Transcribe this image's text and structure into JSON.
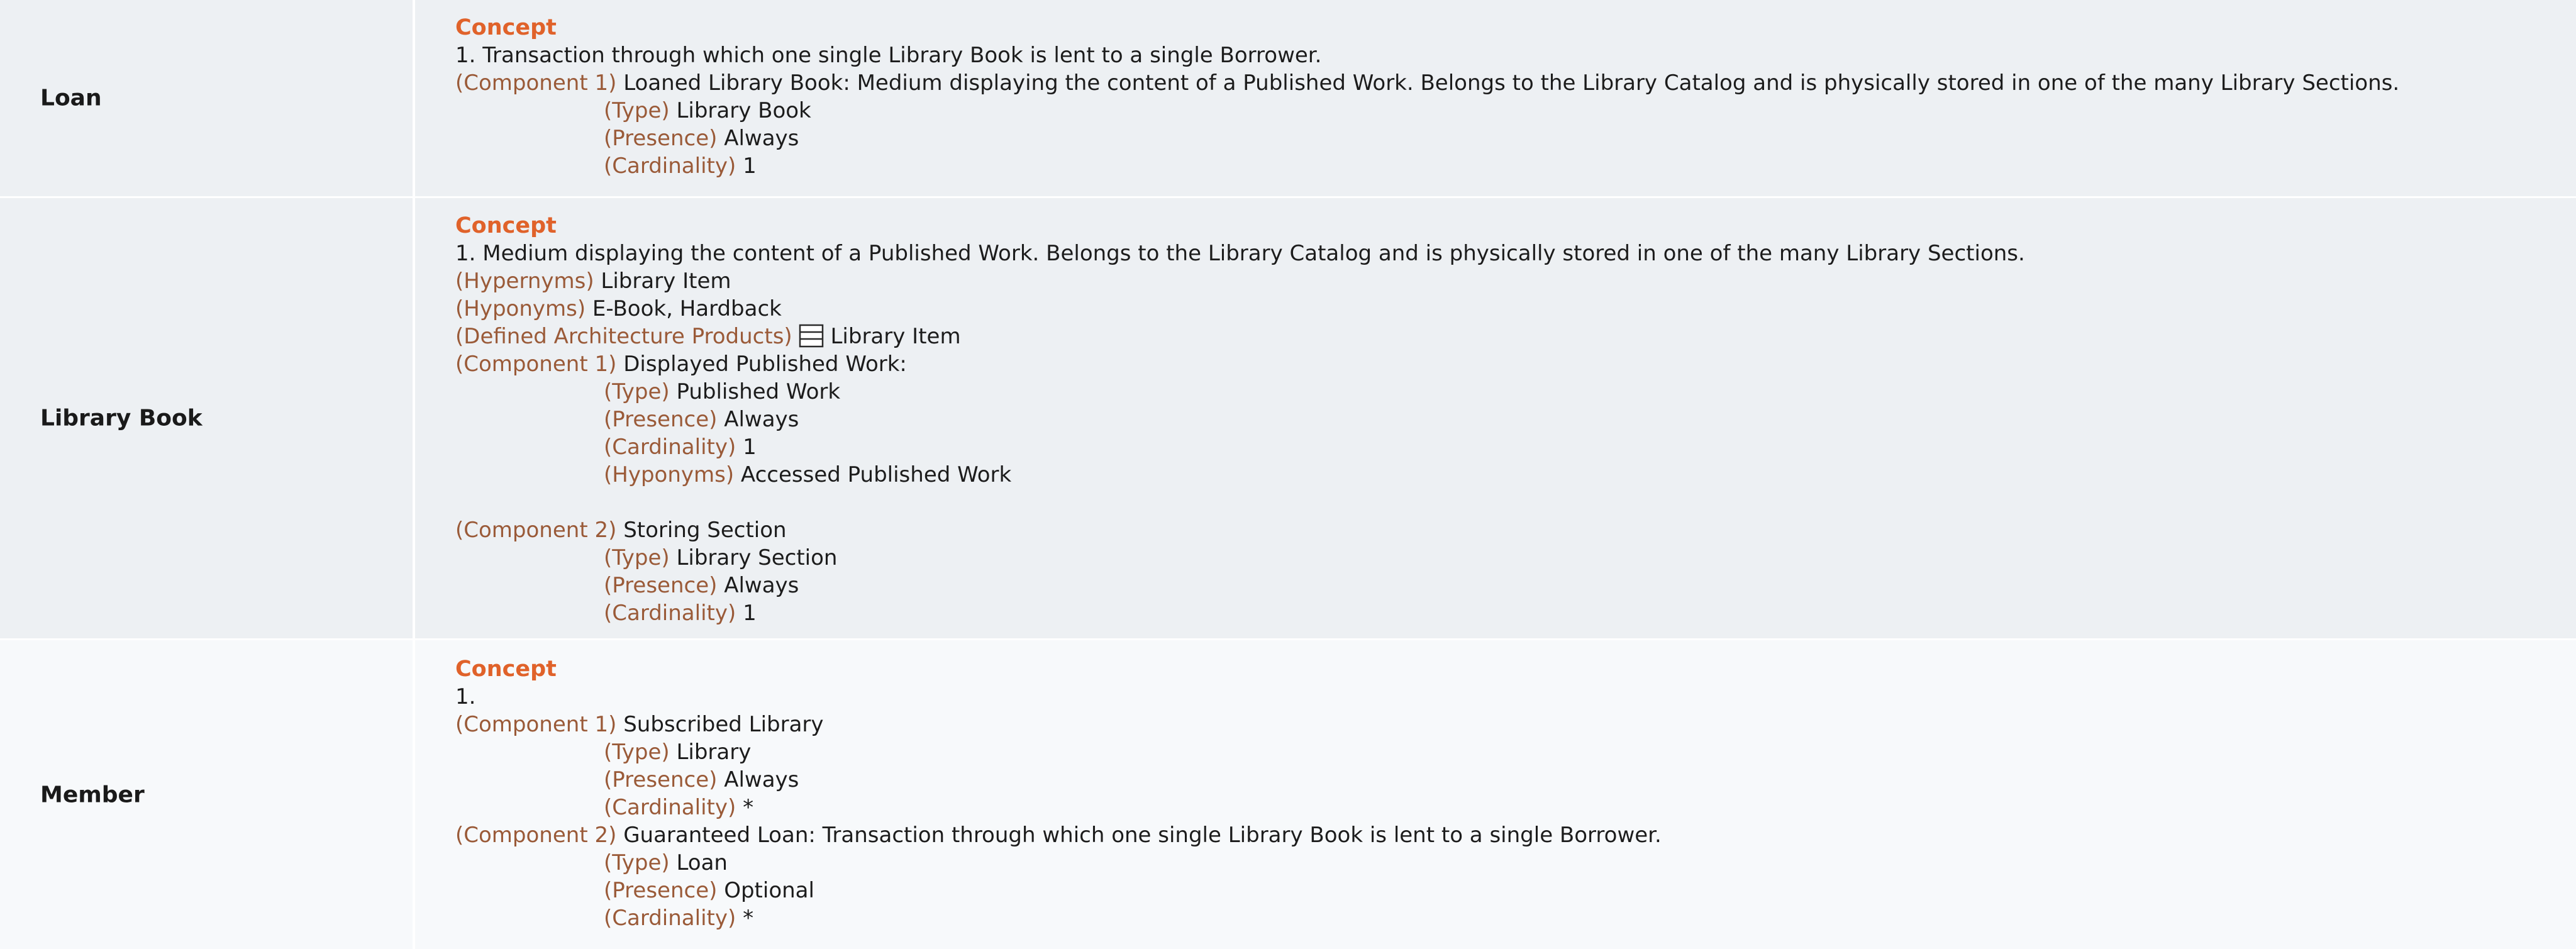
{
  "rows": [
    {
      "term": "Loan",
      "concept_heading": "Concept",
      "definition": "1. Transaction through which one single Library Book is lent to a single Borrower.",
      "component1": {
        "label": "(Component 1)",
        "value": "Loaned Library Book: Medium displaying the content of a Published Work. Belongs to the Library Catalog and is physically stored in one of the many Library Sections.",
        "type_label": "(Type)",
        "type_value": "Library Book",
        "presence_label": "(Presence)",
        "presence_value": "Always",
        "cardinality_label": "(Cardinality)",
        "cardinality_value": "1"
      }
    },
    {
      "term": "Library Book",
      "concept_heading": "Concept",
      "definition": "1. Medium displaying the content of a Published Work. Belongs to the Library Catalog and is physically stored in one of the many Library Sections.",
      "hypernyms_label": "(Hypernyms)",
      "hypernyms_value": "Library Item",
      "hyponyms_label": "(Hyponyms)",
      "hyponyms_value": "E-Book, Hardback",
      "products_label": "(Defined Architecture Products)",
      "products_value": "Library Item",
      "products_icon": "table-icon",
      "component1": {
        "label": "(Component 1)",
        "value": "Displayed Published Work:",
        "type_label": "(Type)",
        "type_value": "Published Work",
        "presence_label": "(Presence)",
        "presence_value": "Always",
        "cardinality_label": "(Cardinality)",
        "cardinality_value": "1",
        "hyponyms_label": "(Hyponyms)",
        "hyponyms_value": "Accessed Published Work"
      },
      "component2": {
        "label": "(Component 2)",
        "value": "Storing Section",
        "type_label": "(Type)",
        "type_value": "Library Section",
        "presence_label": "(Presence)",
        "presence_value": "Always",
        "cardinality_label": "(Cardinality)",
        "cardinality_value": "1"
      }
    },
    {
      "term": "Member",
      "concept_heading": "Concept",
      "definition": "1.",
      "component1": {
        "label": "(Component 1)",
        "value": "Subscribed Library",
        "type_label": "(Type)",
        "type_value": "Library",
        "presence_label": "(Presence)",
        "presence_value": "Always",
        "cardinality_label": "(Cardinality)",
        "cardinality_value": "*"
      },
      "component2": {
        "label": "(Component 2)",
        "value": "Guaranteed Loan: Transaction through which one single Library Book is lent to a single Borrower.",
        "type_label": "(Type)",
        "type_value": "Loan",
        "presence_label": "(Presence)",
        "presence_value": "Optional",
        "cardinality_label": "(Cardinality)",
        "cardinality_value": "*"
      }
    }
  ],
  "colors": {
    "concept_heading": "#e0622a",
    "field_label": "#9a5a38",
    "row_alt_bg": "#edf0f3",
    "row_plain_bg": "#f7f9fb"
  }
}
